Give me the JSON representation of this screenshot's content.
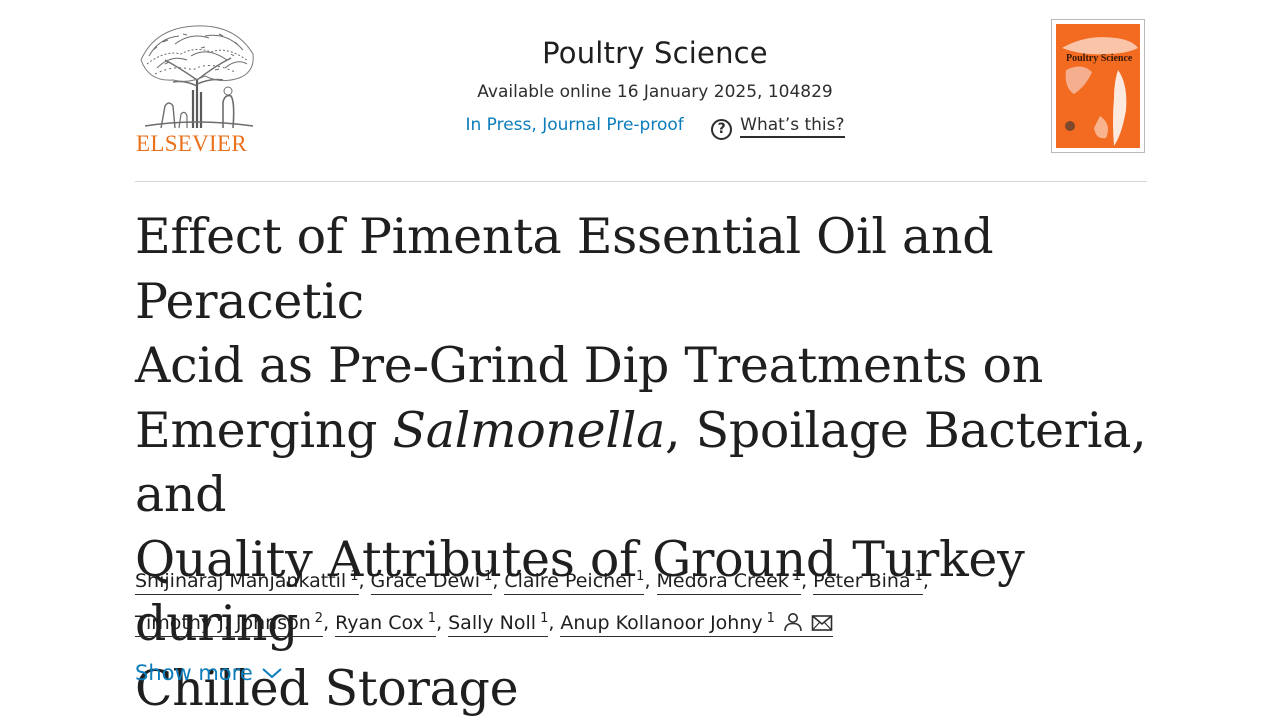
{
  "header": {
    "publisher_name": "ELSEVIER",
    "journal_title": "Poultry Science",
    "availability": "Available online 16 January 2025, 104829",
    "status_link": "In Press, Journal Pre-proof",
    "help_label": "What’s this?",
    "help_icon": "question-circle-icon",
    "cover_title": "Poultry Science",
    "colors": {
      "publisher_orange": "#e9711c",
      "link_blue": "#0c7dbb",
      "cover_orange": "#f26b21"
    }
  },
  "article": {
    "title_lines": [
      "Effect of Pimenta Essential Oil and Peracetic",
      "Acid as Pre-Grind Dip Treatments on",
      "Emerging ",
      "Salmonella",
      ", Spoilage Bacteria, and",
      "Quality Attributes of Ground Turkey during",
      "Chilled Storage"
    ]
  },
  "authors": [
    {
      "name": "Shijinaraj Manjankattil",
      "affiliation": "1"
    },
    {
      "name": "Grace Dewi",
      "affiliation": "1"
    },
    {
      "name": "Claire Peichel",
      "affiliation": "1"
    },
    {
      "name": "Medora Creek",
      "affiliation": "1"
    },
    {
      "name": "Peter Bina",
      "affiliation": "1"
    },
    {
      "name": "Timothy J. Johnson",
      "affiliation": "2"
    },
    {
      "name": "Ryan Cox",
      "affiliation": "1"
    },
    {
      "name": "Sally Noll",
      "affiliation": "1"
    },
    {
      "name": "Anup Kollanoor Johny",
      "affiliation": "1",
      "icons": [
        "person-icon",
        "envelope-icon"
      ]
    }
  ],
  "show_more": {
    "label": "Show more",
    "icon": "chevron-down-icon"
  }
}
